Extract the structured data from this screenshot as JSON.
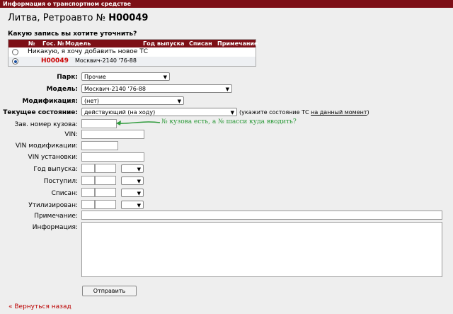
{
  "titlebar": "Информация о транспортном средстве",
  "heading": {
    "prefix": "Литва, ",
    "name": "Ретроавто",
    "num_label": " № ",
    "code": "H00049"
  },
  "question": "Какую запись вы хотите уточнить?",
  "records": {
    "headers": [
      "№",
      "Гос. №",
      "Модель",
      "Год выпуска",
      "Списан",
      "Примечание"
    ],
    "new_option": "Никакую, я хочу добавить новое ТС",
    "row": {
      "code": "H00049",
      "model": "Москвич-2140 '76-88"
    }
  },
  "form": {
    "park_label": "Парк:",
    "park_value": "Прочие",
    "model_label": "Модель:",
    "model_value": "Москвич-2140 '76-88",
    "mod_label": "Модификация:",
    "mod_value": "(нет)",
    "state_label": "Текущее состояние:",
    "state_value": "действующий (на ходу)",
    "state_hint_a": "(укажите состояние ТС ",
    "state_hint_link": "на данный момент",
    "state_hint_b": ")",
    "body_label": "Зав. номер кузова:",
    "vin_label": "VIN:",
    "vinmod_label": "VIN модификации:",
    "vininst_label": "VIN установки:",
    "year_label": "Год выпуска:",
    "recv_label": "Поступил:",
    "off_label": "Списан:",
    "util_label": "Утилизирован:",
    "note_label": "Примечание:",
    "info_label": "Информация:"
  },
  "annotation": "№ кузова есть, а № шасси куда вводить?",
  "submit": "Отправить",
  "back": "« Вернуться назад",
  "colors": {
    "header": "#7d0f16",
    "code": "#cc0000",
    "annotation": "#2d9a3a"
  }
}
